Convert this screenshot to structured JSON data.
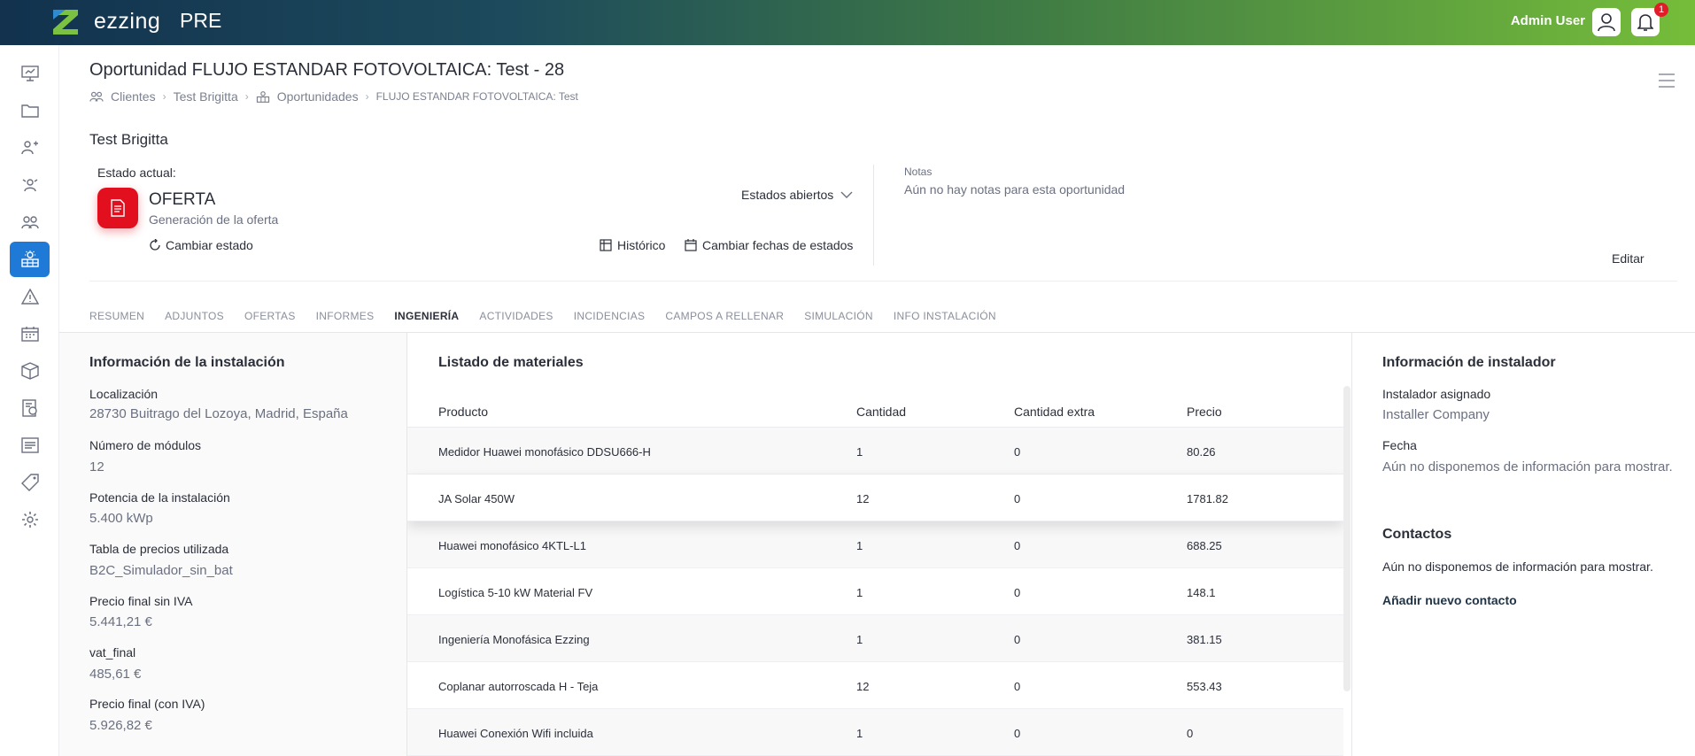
{
  "topbar": {
    "brand": "ezzing",
    "env": "PRE",
    "user_name": "Admin User",
    "notification_count": "1"
  },
  "sidebar": {
    "items": [
      {
        "icon": "dashboard-icon"
      },
      {
        "icon": "folder-icon"
      },
      {
        "icon": "leads-icon"
      },
      {
        "icon": "contacts-icon"
      },
      {
        "icon": "clients-icon"
      },
      {
        "icon": "opportunities-icon",
        "active": true
      },
      {
        "icon": "warning-icon"
      },
      {
        "icon": "calendar-icon"
      },
      {
        "icon": "box-icon"
      },
      {
        "icon": "pricing-icon"
      },
      {
        "icon": "reports-icon"
      },
      {
        "icon": "tag-icon"
      },
      {
        "icon": "settings-icon"
      }
    ]
  },
  "header": {
    "title": "Oportunidad FLUJO ESTANDAR FOTOVOLTAICA: Test - 28",
    "breadcrumb": {
      "clients": "Clientes",
      "customer": "Test Brigitta",
      "opportunities": "Oportunidades",
      "current": "FLUJO ESTANDAR FOTOVOLTAICA: Test"
    }
  },
  "customer_name": "Test Brigitta",
  "estado": {
    "label": "Estado actual:",
    "name": "OFERTA",
    "description": "Generación de la oferta",
    "estados_abiertos": "Estados abiertos",
    "cambiar_estado": "Cambiar estado",
    "historico": "Histórico",
    "cambiar_fechas": "Cambiar fechas de estados",
    "accent": "#e2101f"
  },
  "notas": {
    "label": "Notas",
    "text": "Aún no hay notas para esta oportunidad",
    "edit": "Editar"
  },
  "tabs": [
    "RESUMEN",
    "ADJUNTOS",
    "OFERTAS",
    "INFORMES",
    "INGENIERÍA",
    "ACTIVIDADES",
    "INCIDENCIAS",
    "CAMPOS A RELLENAR",
    "SIMULACIÓN",
    "INFO INSTALACIÓN"
  ],
  "active_tab": "INGENIERÍA",
  "installation": {
    "title": "Información de la instalación",
    "fields": [
      {
        "label": "Localización",
        "value": "28730 Buitrago del Lozoya, Madrid, España"
      },
      {
        "label": "Número de módulos",
        "value": "12"
      },
      {
        "label": "Potencia de la instalación",
        "value": "5.400 kWp"
      },
      {
        "label": "Tabla de precios utilizada",
        "value": "B2C_Simulador_sin_bat"
      },
      {
        "label": "Precio final sin IVA",
        "value": "5.441,21 €"
      },
      {
        "label": "vat_final",
        "value": "485,61 €"
      },
      {
        "label": "Precio final (con IVA)",
        "value": "5.926,82 €"
      }
    ]
  },
  "materials": {
    "title": "Listado de materiales",
    "columns": [
      "Producto",
      "Cantidad",
      "Cantidad extra",
      "Precio"
    ],
    "rows": [
      [
        "Medidor Huawei monofásico DDSU666-H",
        "1",
        "0",
        "80.26"
      ],
      [
        "JA Solar 450W",
        "12",
        "0",
        "1781.82"
      ],
      [
        "Huawei monofásico 4KTL-L1",
        "1",
        "0",
        "688.25"
      ],
      [
        "Logística 5-10 kW Material FV",
        "1",
        "0",
        "148.1"
      ],
      [
        "Ingeniería Monofásica Ezzing",
        "1",
        "0",
        "381.15"
      ],
      [
        "Coplanar autorroscada H - Teja",
        "12",
        "0",
        "553.43"
      ],
      [
        "Huawei Conexión Wifi incluida",
        "1",
        "0",
        "0"
      ]
    ]
  },
  "installer": {
    "title": "Información de instalador",
    "assigned_label": "Instalador asignado",
    "assigned_value": "Installer Company",
    "date_label": "Fecha",
    "date_value": "Aún no disponemos de información para mostrar."
  },
  "contacts": {
    "title": "Contactos",
    "empty": "Aún no disponemos de información para mostrar.",
    "add": "Añadir nuevo contacto"
  }
}
